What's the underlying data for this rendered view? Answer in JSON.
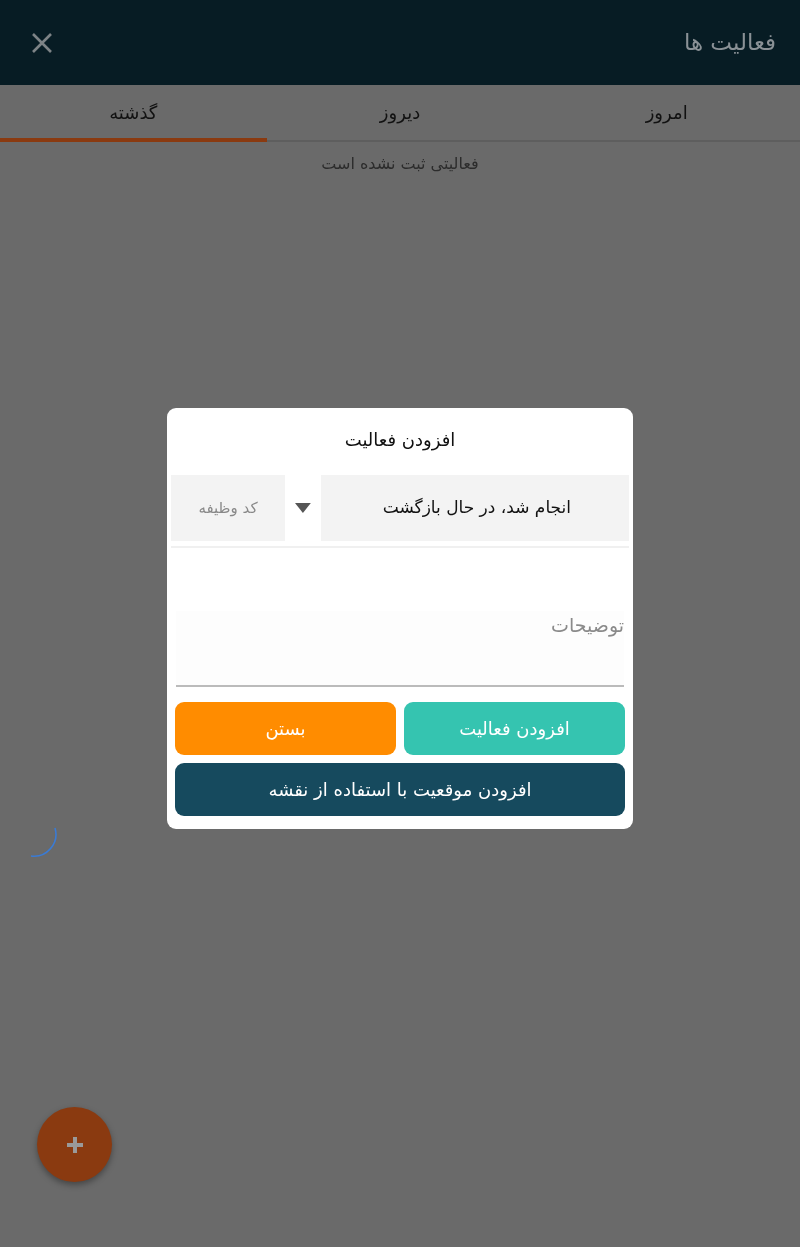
{
  "app_bar": {
    "title": "فعالیت ها"
  },
  "tabs": [
    {
      "label": "امروز",
      "selected": false
    },
    {
      "label": "دیروز",
      "selected": false
    },
    {
      "label": "گذشته",
      "selected": true
    }
  ],
  "empty_message": "فعالیتی ثبت نشده است",
  "dialog": {
    "title": "افزودن فعالیت",
    "status_select": {
      "value": "انجام شد، در حال بازگشت"
    },
    "task_code": {
      "placeholder": "کد وظیفه"
    },
    "description": {
      "placeholder": "توضیحات"
    },
    "buttons": [
      {
        "label": "افزودن فعالیت",
        "kind": "primary"
      },
      {
        "label": "بستن",
        "kind": "close"
      },
      {
        "label": "افزودن موقعیت با استفاده از نقشه",
        "kind": "map"
      }
    ]
  }
}
